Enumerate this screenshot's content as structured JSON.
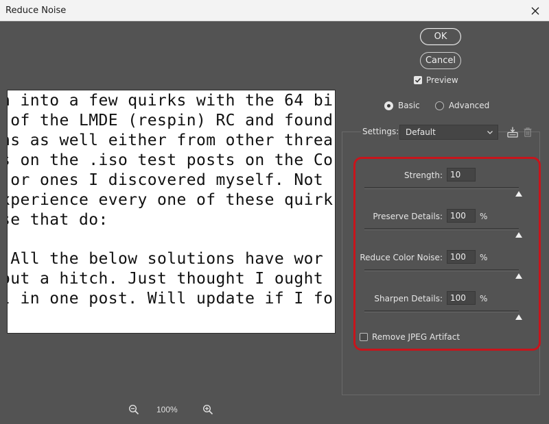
{
  "window": {
    "title": "Reduce Noise"
  },
  "buttons": {
    "ok": "OK",
    "cancel": "Cancel"
  },
  "preview": {
    "label": "Preview",
    "checked": true
  },
  "mode": {
    "basic": "Basic",
    "advanced": "Advanced",
    "selected": "basic"
  },
  "settings": {
    "label": "Settings:",
    "value": "Default"
  },
  "sliders": [
    {
      "label": "Strength:",
      "value": "10",
      "unit": "",
      "level": 1.0
    },
    {
      "label": "Preserve Details:",
      "value": "100",
      "unit": "%",
      "level": 1.0
    },
    {
      "label": "Reduce Color Noise:",
      "value": "100",
      "unit": "%",
      "level": 1.0
    },
    {
      "label": "Sharpen Details:",
      "value": "100",
      "unit": "%",
      "level": 1.0
    }
  ],
  "jpeg": {
    "label": "Remove JPEG Artifact",
    "checked": false
  },
  "zoom": {
    "level": "100%"
  },
  "preview_text": [
    "n into a few quirks with the 64 bi",
    " of the LMDE (respin) RC and found",
    "ns as well either from other threa",
    "s on the .iso test posts on the Co",
    " or ones I discovered myself. Not",
    "xperience every one of these quirk",
    "se that do:",
    "",
    " All the below solutions have wor",
    "out a hitch. Just thought I ought",
    "l in one post. Will update if I fo"
  ],
  "colors": {
    "highlight": "#c8141b",
    "dialog_bg": "#535353"
  }
}
